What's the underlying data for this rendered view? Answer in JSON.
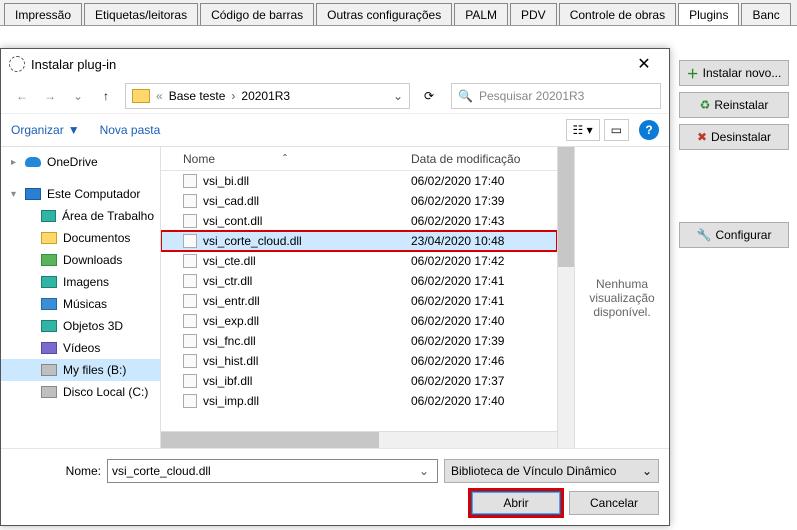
{
  "topbar": {
    "tabs": [
      "Impressão",
      "Etiquetas/leitoras",
      "Código de barras",
      "Outras configurações",
      "PALM",
      "PDV",
      "Controle de obras",
      "Plugins",
      "Banc"
    ],
    "active_index": 7
  },
  "right_panel": {
    "install": "Instalar novo...",
    "reinstall": "Reinstalar",
    "uninstall": "Desinstalar",
    "configure": "Configurar"
  },
  "dialog": {
    "title": "Instalar plug-in",
    "breadcrumb": {
      "prefix": "«",
      "parent": "Base teste",
      "current": "20201R3"
    },
    "search_placeholder": "Pesquisar 20201R3",
    "organize": "Organizar",
    "new_folder": "Nova pasta",
    "columns": {
      "name": "Nome",
      "modified": "Data de modificação"
    },
    "tree": [
      {
        "label": "OneDrive",
        "icon": "cloud",
        "caret": ""
      },
      {
        "label": "",
        "icon": "",
        "caret": ""
      },
      {
        "label": "Este Computador",
        "icon": "pc",
        "caret": "▾"
      },
      {
        "label": "Área de Trabalho",
        "icon": "teal",
        "sub": true
      },
      {
        "label": "Documentos",
        "icon": "folder",
        "sub": true
      },
      {
        "label": "Downloads",
        "icon": "green",
        "sub": true
      },
      {
        "label": "Imagens",
        "icon": "teal",
        "sub": true
      },
      {
        "label": "Músicas",
        "icon": "blue",
        "sub": true
      },
      {
        "label": "Objetos 3D",
        "icon": "teal",
        "sub": true
      },
      {
        "label": "Vídeos",
        "icon": "purple",
        "sub": true
      },
      {
        "label": "My files (B:)",
        "icon": "drive",
        "sub": true,
        "selected": true
      },
      {
        "label": "Disco Local (C:)",
        "icon": "disk",
        "sub": true
      }
    ],
    "files": [
      {
        "name": "vsi_bi.dll",
        "date": "06/02/2020 17:40"
      },
      {
        "name": "vsi_cad.dll",
        "date": "06/02/2020 17:39"
      },
      {
        "name": "vsi_cont.dll",
        "date": "06/02/2020 17:43"
      },
      {
        "name": "vsi_corte_cloud.dll",
        "date": "23/04/2020 10:48",
        "selected": true,
        "highlight": true
      },
      {
        "name": "vsi_cte.dll",
        "date": "06/02/2020 17:42"
      },
      {
        "name": "vsi_ctr.dll",
        "date": "06/02/2020 17:41"
      },
      {
        "name": "vsi_entr.dll",
        "date": "06/02/2020 17:41"
      },
      {
        "name": "vsi_exp.dll",
        "date": "06/02/2020 17:40"
      },
      {
        "name": "vsi_fnc.dll",
        "date": "06/02/2020 17:39"
      },
      {
        "name": "vsi_hist.dll",
        "date": "06/02/2020 17:46"
      },
      {
        "name": "vsi_ibf.dll",
        "date": "06/02/2020 17:37"
      },
      {
        "name": "vsi_imp.dll",
        "date": "06/02/2020 17:40"
      }
    ],
    "preview_text": "Nenhuma visualização disponível.",
    "name_label": "Nome:",
    "name_value": "vsi_corte_cloud.dll",
    "filter_label": "Biblioteca de Vínculo Dinâmico",
    "open": "Abrir",
    "cancel": "Cancelar"
  },
  "icons": {
    "plus": "＋",
    "recycle": "♻",
    "x": "✖",
    "wrench": "🔧",
    "search": "🔍",
    "back": "←",
    "fwd": "→",
    "up": "↑",
    "chev": "›",
    "dd": "⌄",
    "refresh": "⟳",
    "close": "✕",
    "sort": "ˆ",
    "help": "?"
  },
  "colors": {
    "highlight_red": "#d60000",
    "selection_blue": "#cde8ff"
  }
}
